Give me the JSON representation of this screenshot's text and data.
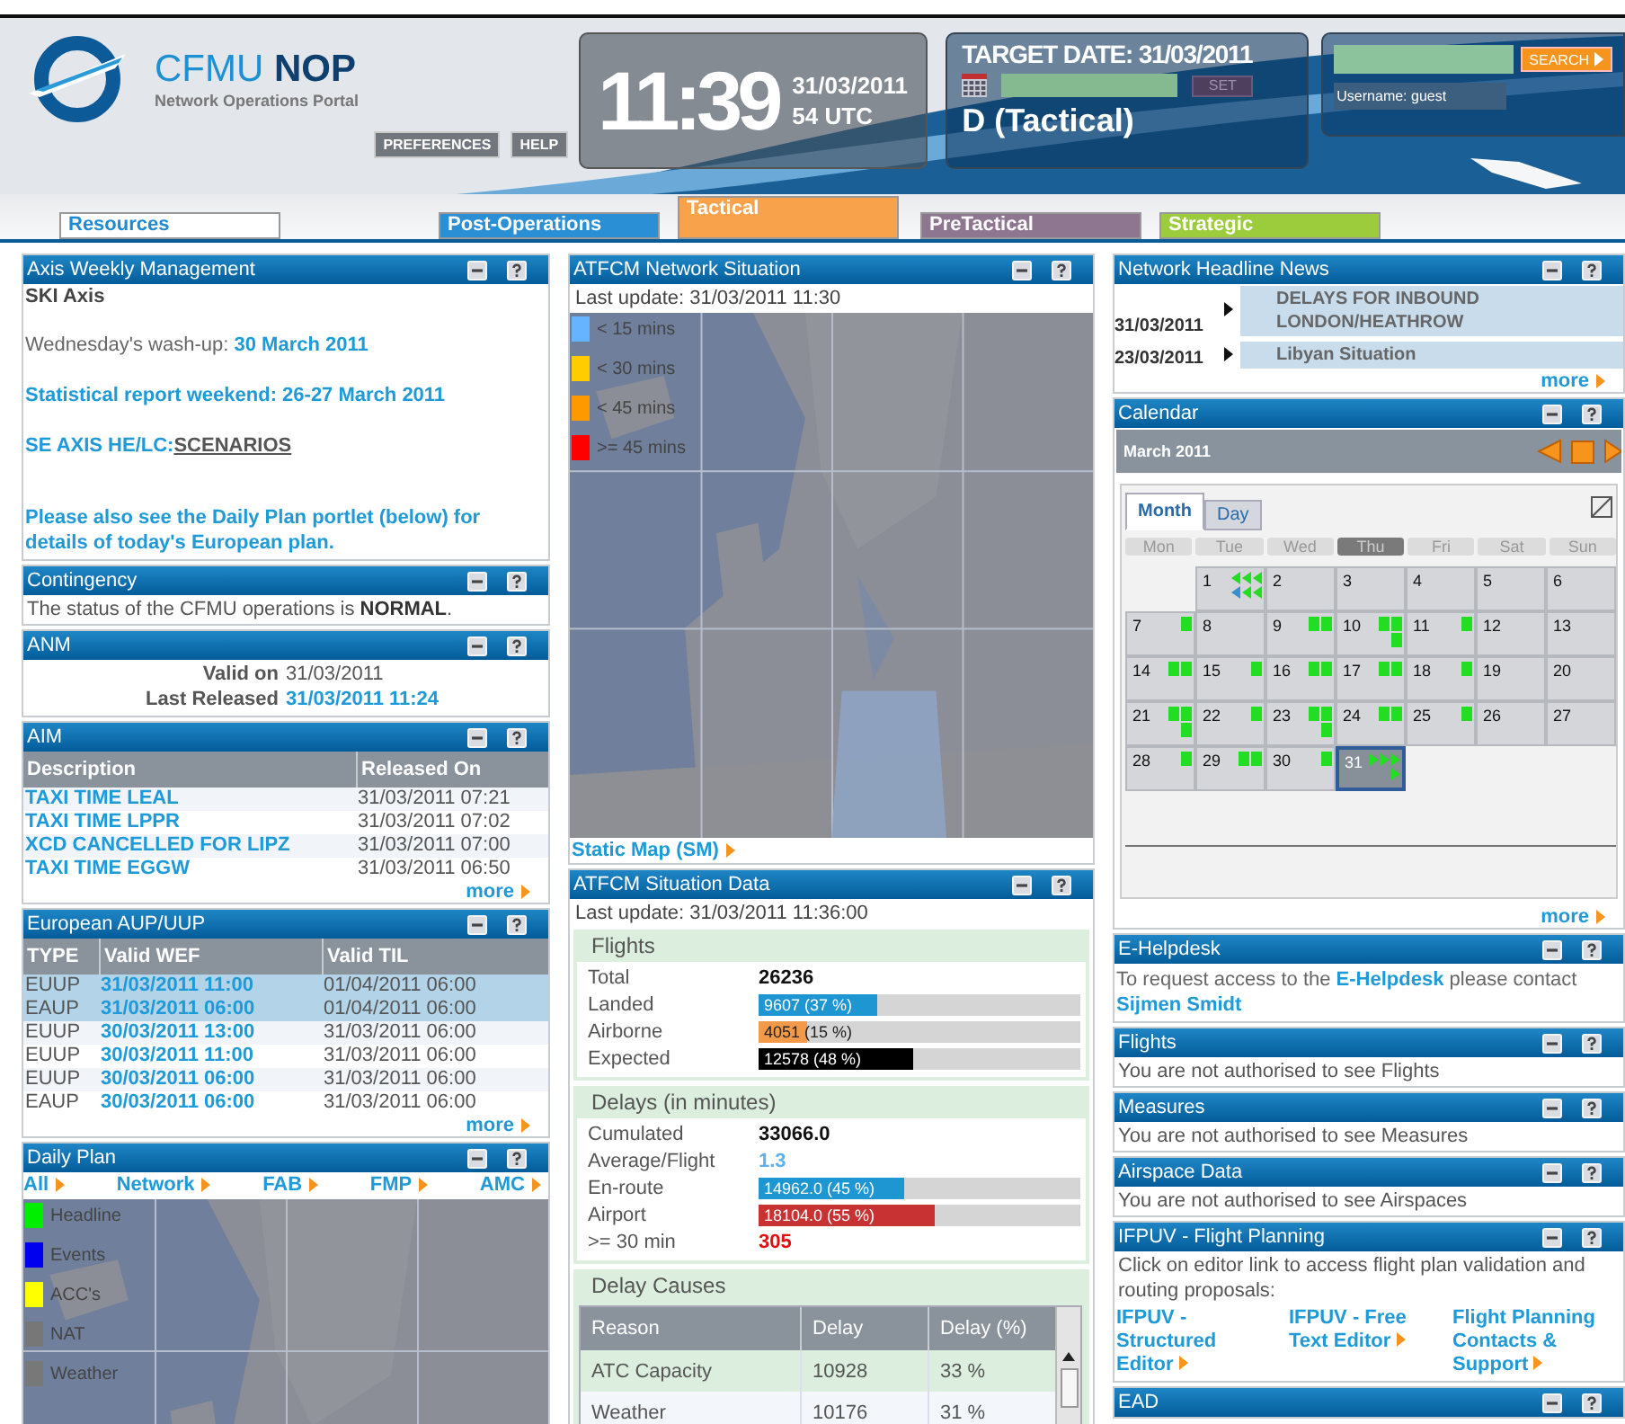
{
  "header": {
    "logo": {
      "title": "CFMU **NOP**",
      "subtitle": "Network Operations Portal"
    },
    "buttons": [
      "PREFERENCES",
      "HELP"
    ],
    "clock": {
      "time": "11:39",
      "date": "31/03/2011",
      "zone_line": "54  UTC"
    },
    "target": {
      "title": "TARGET DATE: 31/03/2011",
      "set_button": "SET",
      "phase": "D (Tactical)"
    },
    "search": {
      "button": "SEARCH",
      "username": "Username: guest"
    }
  },
  "tabs": [
    {
      "label": "Resources",
      "selected": false,
      "color": "#ffffff"
    },
    {
      "label": "Post-Operations",
      "selected": false,
      "color": "#2a8fd4"
    },
    {
      "label": "Tactical",
      "selected": true,
      "color": "#f8a24c"
    },
    {
      "label": "PreTactical",
      "selected": false,
      "color": "#8e7590"
    },
    {
      "label": "Strategic",
      "selected": false,
      "color": "#9ccc3c"
    }
  ],
  "columns": [
    [
      {
        "kind": "notes",
        "title": "Axis Weekly Management",
        "heading": "SKI Axis",
        "paragraphs": [
          [
            {
              "text": "Wednesday's wash-up: "
            },
            {
              "link": "30 March 2011"
            }
          ],
          [
            {
              "link": "Statistical report weekend: 26-27 March 2011"
            }
          ],
          [
            {
              "link": "SE AXIS HE/LC:"
            },
            {
              "underlined": "SCENARIOS"
            }
          ],
          [
            {
              "link": "Please also see the Daily Plan portlet (below) for details of today's European plan."
            }
          ]
        ]
      },
      {
        "kind": "text",
        "title": "Contingency",
        "text": "The status of the CFMU operations is **NORMAL**."
      },
      {
        "kind": "anm",
        "title": "ANM",
        "rows": [
          {
            "label": "Valid on",
            "value": "31/03/2011",
            "link": false
          },
          {
            "label": "Last Released",
            "value": "31/03/2011 11:24",
            "link": true
          }
        ]
      },
      {
        "kind": "table",
        "title": "AIM",
        "columns": [
          {
            "label": "Description",
            "link": true
          },
          {
            "label": "Released On",
            "link": false
          }
        ],
        "rows": [
          {
            "cells": [
              "TAXI TIME LEAL",
              "31/03/2011 07:21"
            ]
          },
          {
            "cells": [
              "TAXI TIME LPPR",
              "31/03/2011 07:02"
            ]
          },
          {
            "cells": [
              "XCD CANCELLED FOR LIPZ",
              "31/03/2011 07:00"
            ]
          },
          {
            "cells": [
              "TAXI TIME EGGW",
              "31/03/2011 06:50"
            ]
          }
        ],
        "more": "more"
      },
      {
        "kind": "table",
        "title": "European AUP/UUP",
        "columns": [
          {
            "label": "TYPE",
            "link": false
          },
          {
            "label": "Valid WEF",
            "link": true
          },
          {
            "label": "Valid TIL",
            "link": false
          }
        ],
        "rows": [
          {
            "cells": [
              "EUUP",
              "31/03/2011 11:00",
              "01/04/2011 06:00"
            ],
            "selected": true
          },
          {
            "cells": [
              "EAUP",
              "31/03/2011 06:00",
              "01/04/2011 06:00"
            ],
            "selected": true
          },
          {
            "cells": [
              "EUUP",
              "30/03/2011 13:00",
              "31/03/2011 06:00"
            ],
            "selected": false
          },
          {
            "cells": [
              "EUUP",
              "30/03/2011 11:00",
              "31/03/2011 06:00"
            ],
            "selected": false
          },
          {
            "cells": [
              "EUUP",
              "30/03/2011 06:00",
              "31/03/2011 06:00"
            ],
            "selected": false
          },
          {
            "cells": [
              "EAUP",
              "30/03/2011 06:00",
              "31/03/2011 06:00"
            ],
            "selected": false
          }
        ],
        "more": "more"
      },
      {
        "kind": "daily_plan",
        "title": "Daily Plan",
        "filters": [
          "All",
          "Network",
          "FAB",
          "FMP",
          "AMC"
        ],
        "legend": [
          {
            "label": "Headline",
            "color": "#00ee00"
          },
          {
            "label": "Events",
            "color": "#0000ee"
          },
          {
            "label": "ACC's",
            "color": "#ffff00"
          },
          {
            "label": "NAT",
            "color": "#777777"
          },
          {
            "label": "Weather",
            "color": "#787878"
          }
        ]
      }
    ],
    [
      {
        "kind": "map",
        "title": "ATFCM Network Situation",
        "updated": "Last update: 31/03/2011 11:30",
        "legend": [
          {
            "label": "< 15 mins",
            "color": "#66b3ff"
          },
          {
            "label": "< 30 mins",
            "color": "#ffcc00"
          },
          {
            "label": "< 45 mins",
            "color": "#ff9900"
          },
          {
            "label": ">= 45 mins",
            "color": "#ff0000"
          }
        ],
        "link": "Static Map (SM)"
      },
      {
        "kind": "situation",
        "title": "ATFCM Situation Data",
        "updated": "Last update: 31/03/2011 11:36:00",
        "sections": [
          {
            "title": "Flights",
            "rows": [
              {
                "kind": "value",
                "label": "Total",
                "value": "26236"
              },
              {
                "kind": "bar",
                "label": "Landed",
                "value": "9607 (37 %)",
                "level": 0.37,
                "color": "#1e96d2"
              },
              {
                "kind": "bar",
                "label": "Airborne",
                "value": "4051 (15 %)",
                "level": 0.15,
                "color": "#f29a4a"
              },
              {
                "kind": "bar",
                "label": "Expected",
                "value": "12578 (48 %)",
                "level": 0.48,
                "color": "#000000"
              }
            ]
          },
          {
            "title": "Delays (in minutes)",
            "rows": [
              {
                "kind": "value",
                "label": "Cumulated",
                "value": "33066.0"
              },
              {
                "kind": "link",
                "label": "Average/Flight",
                "value": "1.3"
              },
              {
                "kind": "bar",
                "label": "En-route",
                "value": "14962.0 (45 %)",
                "level": 0.45,
                "color": "#1e96d2"
              },
              {
                "kind": "bar",
                "label": "Airport",
                "value": "18104.0 (55 %)",
                "level": 0.55,
                "color": "#c83232"
              },
              {
                "kind": "alert",
                "label": ">= 30 min",
                "value": "305"
              }
            ]
          }
        ],
        "causes": {
          "title": "Delay Causes",
          "columns": [
            "Reason",
            "Delay",
            "Delay (%)"
          ],
          "rows": [
            [
              "ATC Capacity",
              "10928",
              "33 %"
            ],
            [
              "Weather",
              "10176",
              "31 %"
            ]
          ]
        }
      }
    ],
    [
      {
        "kind": "news",
        "title": "Network Headline News",
        "items": [
          {
            "date": "31/03/2011",
            "headline": "DELAYS FOR INBOUND LONDON/HEATHROW"
          },
          {
            "date": "23/03/2011",
            "headline": "Libyan Situation"
          }
        ],
        "more": "more"
      },
      {
        "kind": "calendar",
        "title": "Calendar",
        "month": "March 2011",
        "views": [
          {
            "label": "Month",
            "selected": true
          },
          {
            "label": "Day",
            "selected": false
          }
        ],
        "weekdays": [
          {
            "label": "Mon",
            "selected": false
          },
          {
            "label": "Tue",
            "selected": false
          },
          {
            "label": "Wed",
            "selected": false
          },
          {
            "label": "Thu",
            "selected": true
          },
          {
            "label": "Fri",
            "selected": false
          },
          {
            "label": "Sat",
            "selected": false
          },
          {
            "label": "Sun",
            "selected": false
          }
        ],
        "weeks": [
          [
            {
              "label": "1",
              "selected": false,
              "marks": [
                {
                  "kind": "left",
                  "color": "#22dd22"
                },
                {
                  "kind": "left",
                  "color": "#22dd22"
                },
                {
                  "kind": "left",
                  "color": "#22dd22"
                },
                {
                  "kind": "left",
                  "color": "#3a8fd0"
                },
                {
                  "kind": "left",
                  "color": "#22dd22"
                },
                {
                  "kind": "left",
                  "color": "#22dd22"
                }
              ]
            },
            {
              "label": "2",
              "selected": false
            },
            {
              "label": "3",
              "selected": false
            },
            {
              "label": "4",
              "selected": false
            },
            {
              "label": "5",
              "selected": false
            },
            {
              "label": "6",
              "selected": false
            }
          ],
          [
            {
              "label": "7",
              "selected": false,
              "marks": [
                {
                  "kind": "bar",
                  "color": "#22dd22"
                }
              ]
            },
            {
              "label": "8",
              "selected": false
            },
            {
              "label": "9",
              "selected": false,
              "marks": [
                {
                  "kind": "bar",
                  "color": "#22dd22"
                },
                {
                  "kind": "bar",
                  "color": "#22dd22"
                }
              ]
            },
            {
              "label": "10",
              "selected": false,
              "marks": [
                {
                  "kind": "bar",
                  "color": "#22dd22"
                },
                {
                  "kind": "bar",
                  "color": "#22dd22"
                },
                {
                  "kind": "bar",
                  "color": "#22dd22"
                }
              ]
            },
            {
              "label": "11",
              "selected": false,
              "marks": [
                {
                  "kind": "bar",
                  "color": "#22dd22"
                }
              ]
            },
            {
              "label": "12",
              "selected": false
            },
            {
              "label": "13",
              "selected": false
            }
          ],
          [
            {
              "label": "14",
              "selected": false,
              "marks": [
                {
                  "kind": "bar",
                  "color": "#22dd22"
                },
                {
                  "kind": "bar",
                  "color": "#22dd22"
                }
              ]
            },
            {
              "label": "15",
              "selected": false,
              "marks": [
                {
                  "kind": "bar",
                  "color": "#22dd22"
                }
              ]
            },
            {
              "label": "16",
              "selected": false,
              "marks": [
                {
                  "kind": "bar",
                  "color": "#22dd22"
                },
                {
                  "kind": "bar",
                  "color": "#22dd22"
                }
              ]
            },
            {
              "label": "17",
              "selected": false,
              "marks": [
                {
                  "kind": "bar",
                  "color": "#22dd22"
                },
                {
                  "kind": "bar",
                  "color": "#22dd22"
                }
              ]
            },
            {
              "label": "18",
              "selected": false,
              "marks": [
                {
                  "kind": "bar",
                  "color": "#22dd22"
                }
              ]
            },
            {
              "label": "19",
              "selected": false
            },
            {
              "label": "20",
              "selected": false
            }
          ],
          [
            {
              "label": "21",
              "selected": false,
              "marks": [
                {
                  "kind": "bar",
                  "color": "#22dd22"
                },
                {
                  "kind": "bar",
                  "color": "#22dd22"
                },
                {
                  "kind": "bar",
                  "color": "#22dd22"
                }
              ]
            },
            {
              "label": "22",
              "selected": false,
              "marks": [
                {
                  "kind": "bar",
                  "color": "#22dd22"
                }
              ]
            },
            {
              "label": "23",
              "selected": false,
              "marks": [
                {
                  "kind": "bar",
                  "color": "#22dd22"
                },
                {
                  "kind": "bar",
                  "color": "#22dd22"
                },
                {
                  "kind": "bar",
                  "color": "#22dd22"
                }
              ]
            },
            {
              "label": "24",
              "selected": false,
              "marks": [
                {
                  "kind": "bar",
                  "color": "#22dd22"
                },
                {
                  "kind": "bar",
                  "color": "#22dd22"
                }
              ]
            },
            {
              "label": "25",
              "selected": false,
              "marks": [
                {
                  "kind": "bar",
                  "color": "#22dd22"
                }
              ]
            },
            {
              "label": "26",
              "selected": false
            },
            {
              "label": "27",
              "selected": false
            }
          ],
          [
            {
              "label": "28",
              "selected": false,
              "marks": [
                {
                  "kind": "bar",
                  "color": "#22dd22"
                }
              ]
            },
            {
              "label": "29",
              "selected": false,
              "marks": [
                {
                  "kind": "bar",
                  "color": "#22dd22"
                },
                {
                  "kind": "bar",
                  "color": "#22dd22"
                }
              ]
            },
            {
              "label": "30",
              "selected": false,
              "marks": [
                {
                  "kind": "bar",
                  "color": "#22dd22"
                }
              ]
            },
            {
              "label": "31",
              "selected": true,
              "marks": [
                {
                  "kind": "right",
                  "color": "#22dd22"
                },
                {
                  "kind": "right",
                  "color": "#22dd22"
                },
                {
                  "kind": "right",
                  "color": "#22dd22"
                },
                {
                  "kind": "right",
                  "color": "#22dd22"
                }
              ]
            }
          ]
        ],
        "more": "more"
      },
      {
        "kind": "notes",
        "title": "E-Helpdesk",
        "paragraphs": [
          [
            {
              "text": "To request access to the "
            },
            {
              "link": "E-Helpdesk"
            },
            {
              "text": " please contact "
            },
            {
              "link": "Sijmen Smidt"
            }
          ]
        ]
      },
      {
        "kind": "text",
        "title": "Flights",
        "text": "You are not authorised to see Flights"
      },
      {
        "kind": "text",
        "title": "Measures",
        "text": "You are not authorised to see Measures"
      },
      {
        "kind": "text",
        "title": "Airspace Data",
        "text": "You are not authorised to see Airspaces"
      },
      {
        "kind": "links",
        "title": "IFPUV - Flight Planning",
        "text": "Click on editor link to access flight plan validation and routing proposals:",
        "links": [
          "IFPUV - Structured Editor",
          "IFPUV - Free Text Editor",
          "Flight Planning Contacts & Support"
        ]
      },
      {
        "kind": "empty",
        "title": "EAD"
      }
    ]
  ]
}
